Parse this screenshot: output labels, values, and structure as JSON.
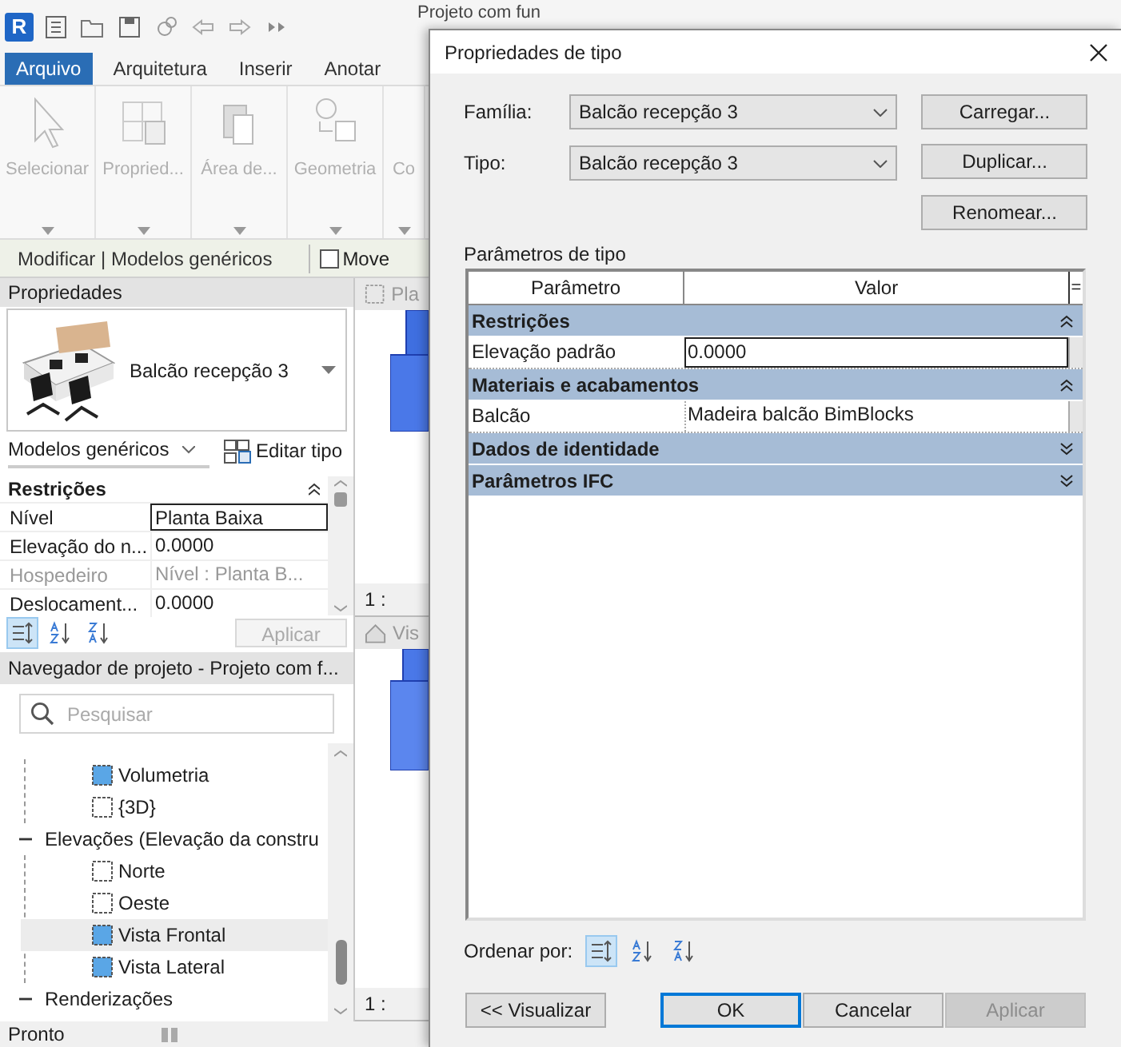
{
  "app": {
    "logo": "R",
    "title": "Projeto com fun",
    "tabs": [
      {
        "label": "Arquivo",
        "selected": true
      },
      {
        "label": "Arquitetura",
        "selected": false
      },
      {
        "label": "Inserir",
        "selected": false
      },
      {
        "label": "Anotar",
        "selected": false
      }
    ],
    "ribbon_buttons": [
      {
        "label": "Selecionar",
        "kind": "select",
        "disabled": true
      },
      {
        "label": "Propried...",
        "kind": "properties",
        "disabled": true
      },
      {
        "label": "Área de...",
        "kind": "clipboard",
        "disabled": true
      },
      {
        "label": "Geometria",
        "kind": "geometry",
        "disabled": true
      },
      {
        "label": "Co",
        "kind": "other",
        "disabled": true
      }
    ],
    "context_bar": {
      "label": "Modificar | Modelos genéricos",
      "option": {
        "label": "Move",
        "checked": false
      }
    },
    "views": [
      {
        "tab": "Pla",
        "kind": "plan",
        "scale": "1 :"
      },
      {
        "tab": "Vis",
        "kind": "perspective",
        "scale": "1 :"
      }
    ],
    "status": "Pronto"
  },
  "properties": {
    "title": "Propriedades",
    "type_name": "Balcão recepção 3",
    "category": "Modelos genéricos",
    "edit_type": "Editar tipo",
    "group": "Restrições",
    "rows": [
      {
        "name": "Nível",
        "value": "Planta Baixa",
        "editing": true,
        "disabled": false
      },
      {
        "name": "Elevação do n...",
        "value": "0.0000",
        "editing": false,
        "disabled": false
      },
      {
        "name": "Hospedeiro",
        "value": "Nível : Planta B...",
        "editing": false,
        "disabled": true
      },
      {
        "name": "Deslocament...",
        "value": "0.0000",
        "editing": false,
        "disabled": false
      }
    ],
    "sort": [
      {
        "kind": "category",
        "selected": true
      },
      {
        "kind": "az",
        "selected": false
      },
      {
        "kind": "za",
        "selected": false
      }
    ],
    "apply": "Aplicar"
  },
  "browser": {
    "title": "Navegador de projeto - Projeto com f...",
    "search_placeholder": "Pesquisar",
    "tree": [
      {
        "children": [
          {
            "label": "Volumetria",
            "placed": true,
            "selected": false
          },
          {
            "label": "{3D}",
            "placed": false,
            "selected": false
          }
        ]
      },
      {
        "label": "Elevações (Elevação da constru",
        "expanded": true,
        "children": [
          {
            "label": "Norte",
            "placed": false,
            "selected": false
          },
          {
            "label": "Oeste",
            "placed": false,
            "selected": false
          },
          {
            "label": "Vista Frontal",
            "placed": true,
            "selected": true
          },
          {
            "label": "Vista Lateral",
            "placed": true,
            "selected": false
          }
        ]
      },
      {
        "label": "Renderizações",
        "expanded": true
      }
    ]
  },
  "dialog": {
    "title": "Propriedades de tipo",
    "family_label": "Família:",
    "family": "Balcão recepção 3",
    "type_label": "Tipo:",
    "type": "Balcão recepção 3",
    "side_buttons": [
      "Carregar...",
      "Duplicar...",
      "Renomear..."
    ],
    "section": "Parâmetros de tipo",
    "columns": [
      "Parâmetro",
      "Valor"
    ],
    "header_button": "=",
    "groups": [
      {
        "name": "Restrições",
        "expanded": true,
        "rows": [
          {
            "name": "Elevação padrão",
            "value": "0.0000",
            "editing": true
          }
        ]
      },
      {
        "name": "Materiais e acabamentos",
        "expanded": true,
        "rows": [
          {
            "name": "Balcão",
            "value": "Madeira balcão BimBlocks",
            "editing": false
          }
        ]
      },
      {
        "name": "Dados de identidade",
        "expanded": false
      },
      {
        "name": "Parâmetros IFC",
        "expanded": false
      }
    ],
    "sort_label": "Ordenar por:",
    "sort": [
      {
        "kind": "category",
        "selected": true
      },
      {
        "kind": "az",
        "selected": false
      },
      {
        "kind": "za",
        "selected": false
      }
    ],
    "buttons": [
      {
        "label": "<< Visualizar",
        "kind": "normal"
      },
      {
        "label": "OK",
        "kind": "default"
      },
      {
        "label": "Cancelar",
        "kind": "normal"
      },
      {
        "label": "Aplicar",
        "kind": "disabled"
      }
    ]
  }
}
